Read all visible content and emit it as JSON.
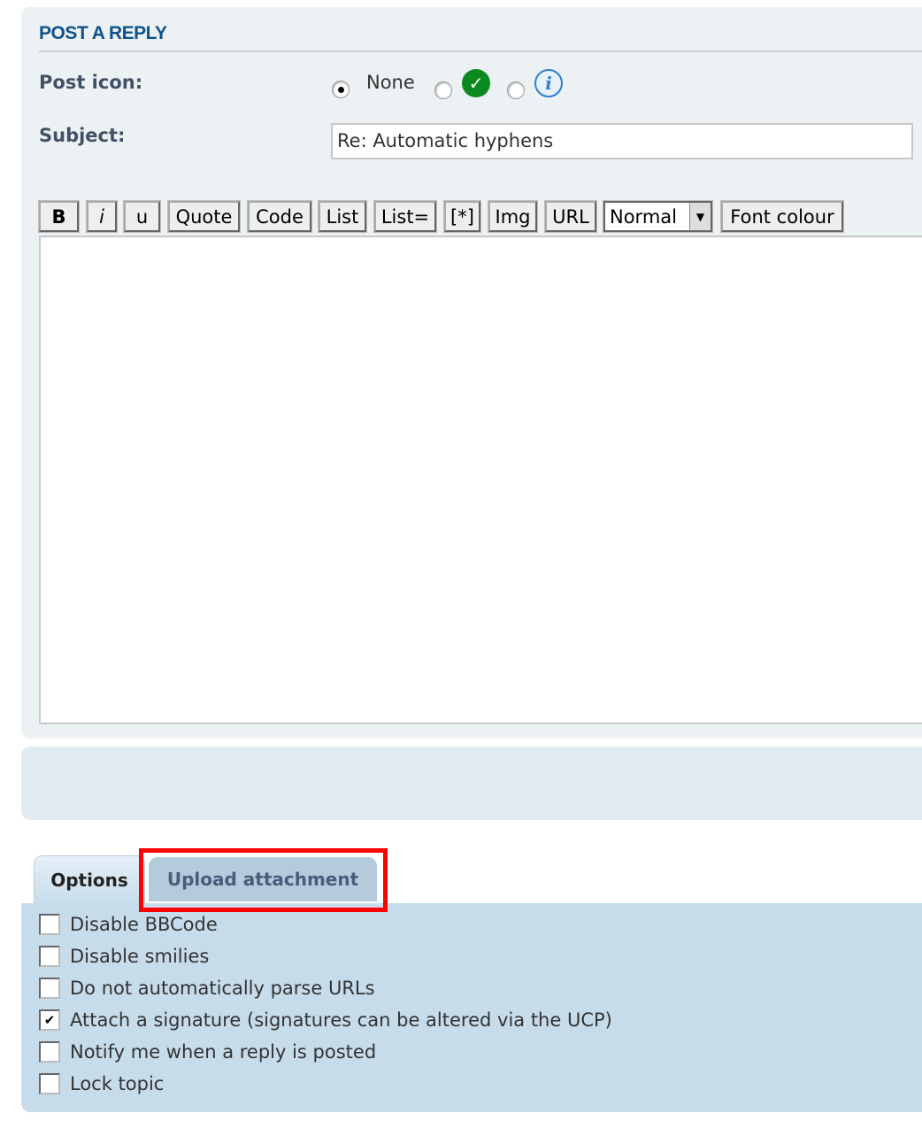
{
  "title": "POST A REPLY",
  "post_icon": {
    "label": "Post icon:",
    "options": [
      {
        "label": "None",
        "selected": true
      },
      {
        "icon": "green-check-icon",
        "selected": false
      },
      {
        "icon": "info-icon",
        "selected": false
      }
    ]
  },
  "subject": {
    "label": "Subject:",
    "value": "Re: Automatic hyphens"
  },
  "toolbar": {
    "bold": "B",
    "italic": "i",
    "underline": "u",
    "quote": "Quote",
    "code": "Code",
    "list": "List",
    "list_eq": "List=",
    "list_item": "[*]",
    "img": "Img",
    "url": "URL",
    "font_size": "Normal",
    "font_colour": "Font colour"
  },
  "message": {
    "value": ""
  },
  "tabs": [
    {
      "label": "Options",
      "active": true
    },
    {
      "label": "Upload attachment",
      "active": false,
      "highlighted": true
    }
  ],
  "options": [
    {
      "label": "Disable BBCode",
      "checked": false
    },
    {
      "label": "Disable smilies",
      "checked": false
    },
    {
      "label": "Do not automatically parse URLs",
      "checked": false
    },
    {
      "label": "Attach a signature (signatures can be altered via the UCP)",
      "checked": true
    },
    {
      "label": "Notify me when a reply is posted",
      "checked": false
    },
    {
      "label": "Lock topic",
      "checked": false
    }
  ],
  "colors": {
    "title": "#105289",
    "highlight": "#ff0000",
    "check_icon": "#0a8a1e",
    "info_icon": "#2d7fd0"
  }
}
